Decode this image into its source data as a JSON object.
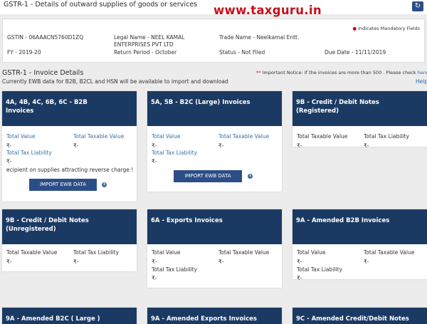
{
  "header": {
    "title": "GSTR-1 - Details of outward supplies of goods or services",
    "watermark": "www.taxguru.in",
    "refresh_icon": "refresh-icon"
  },
  "info": {
    "mandatory_note": "Indicates Mandatory Fields",
    "gstin": "GSTIN - 06AAACN5760D1ZQ",
    "legal_name_1": "Legal Name - NEEL KAMAL",
    "legal_name_2": "ENTERPRISES PVT LTD",
    "trade_name": "Trade Name - Neelkamal Entt.",
    "fy": "FY - 2019-20",
    "return_period": "Return Period - October",
    "status": "Status - Not Filed",
    "due_date": "Due Date - 11/11/2019"
  },
  "section": {
    "title": "GSTR-1 - Invoice Details",
    "notice": "Important Notice: If the invoices are more than 500 . Please check",
    "notice_link": "here",
    "ewb_note": "Currently EWB data for B2B, B2CL and HSN will be available to import and download",
    "help_link": "Help"
  },
  "tiles": {
    "b2b": {
      "title_1": "4A, 4B, 4C, 6B, 6C - B2B",
      "title_2": "Invoices",
      "total_value_label": "Total Value",
      "total_value": "₹-",
      "taxable_label": "Total Taxable Value",
      "taxable": "₹-",
      "tax_label": "Total Tax Liability",
      "tax": "₹-",
      "reverse_charge": "ecipient on supplies attracting reverse charge !",
      "import_button": "IMPORT EWB DATA"
    },
    "b2c_large": {
      "title_1": "5A, 5B - B2C (Large) Invoices",
      "total_value_label": "Total Value",
      "total_value": "₹-",
      "taxable_label": "Total Taxable Value",
      "taxable": "₹-",
      "tax_label": "Total Tax Liability",
      "tax": "₹-",
      "import_button": "IMPORT EWB DATA"
    },
    "cdn_registered": {
      "title_1": "9B - Credit / Debit Notes",
      "title_2": "(Registered)",
      "taxable_label": "Total Taxable Value",
      "taxable": "₹-",
      "tax_label": "Total Tax Liability",
      "tax": "₹-"
    },
    "cdn_unregistered": {
      "title_1": "9B - Credit / Debit Notes",
      "title_2": "(Unregistered)",
      "taxable_label": "Total Taxable Value",
      "taxable": "₹-",
      "tax_label": "Total Tax Liability",
      "tax": "₹-"
    },
    "exports": {
      "title_1": "6A - Exports Invoices",
      "total_value_label": "Total Value",
      "total_value": "₹-",
      "taxable_label": "Total Taxable Value",
      "taxable": "₹-",
      "tax_label": "Total Tax Liability",
      "tax": "₹-"
    },
    "amended_b2b": {
      "title_1": "9A - Amended B2B Invoices",
      "total_value_label": "Total Value",
      "total_value": "₹-",
      "taxable_label": "Total Taxable Value",
      "taxable": "₹-",
      "tax_label": "Total Tax Liability",
      "tax": "₹-"
    },
    "amended_b2c_large": {
      "title_1": "9A - Amended B2C ( Large )"
    },
    "amended_exports": {
      "title_1": "9A - Amended Exports Invoices"
    },
    "amended_cdn": {
      "title_1": "9C - Amended Credit/Debit Notes"
    }
  },
  "colors": {
    "tile_header": "#1b3a63",
    "button": "#2c4e86",
    "label_blue": "#3a6ea8",
    "watermark_red": "#c8101a"
  }
}
